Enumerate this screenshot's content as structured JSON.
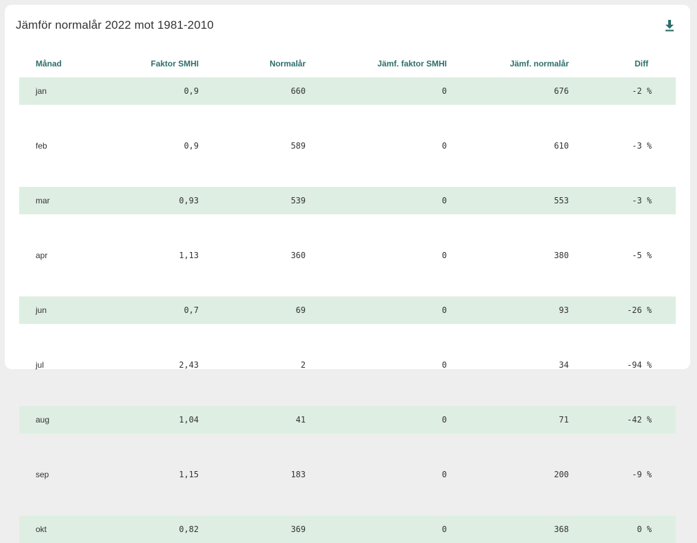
{
  "card": {
    "title": "Jämför normalår 2022 mot 1981-2010",
    "download_icon": "download-icon"
  },
  "colors": {
    "header_text": "#2c6e6a",
    "row_shade": "#deeee3",
    "background": "#eeeeee"
  },
  "table": {
    "headers": {
      "month": "Månad",
      "factor": "Faktor SMHI",
      "normal": "Normalår",
      "cmp_factor": "Jämf. faktor SMHI",
      "cmp_normal": "Jämf. normalår",
      "diff": "Diff"
    },
    "rows": [
      {
        "month": "jan",
        "factor": "0,9",
        "normal": "660",
        "cmp_factor": "0",
        "cmp_normal": "676",
        "diff": "-2 %"
      },
      {
        "month": "feb",
        "factor": "0,9",
        "normal": "589",
        "cmp_factor": "0",
        "cmp_normal": "610",
        "diff": "-3 %"
      },
      {
        "month": "mar",
        "factor": "0,93",
        "normal": "539",
        "cmp_factor": "0",
        "cmp_normal": "553",
        "diff": "-3 %"
      },
      {
        "month": "apr",
        "factor": "1,13",
        "normal": "360",
        "cmp_factor": "0",
        "cmp_normal": "380",
        "diff": "-5 %"
      },
      {
        "month": "jun",
        "factor": "0,7",
        "normal": "69",
        "cmp_factor": "0",
        "cmp_normal": "93",
        "diff": "-26 %"
      },
      {
        "month": "jul",
        "factor": "2,43",
        "normal": "2",
        "cmp_factor": "0",
        "cmp_normal": "34",
        "diff": "-94 %"
      },
      {
        "month": "aug",
        "factor": "1,04",
        "normal": "41",
        "cmp_factor": "0",
        "cmp_normal": "71",
        "diff": "-42 %"
      },
      {
        "month": "sep",
        "factor": "1,15",
        "normal": "183",
        "cmp_factor": "0",
        "cmp_normal": "200",
        "diff": "-9 %"
      },
      {
        "month": "okt",
        "factor": "0,82",
        "normal": "369",
        "cmp_factor": "0",
        "cmp_normal": "368",
        "diff": "0 %"
      }
    ]
  }
}
